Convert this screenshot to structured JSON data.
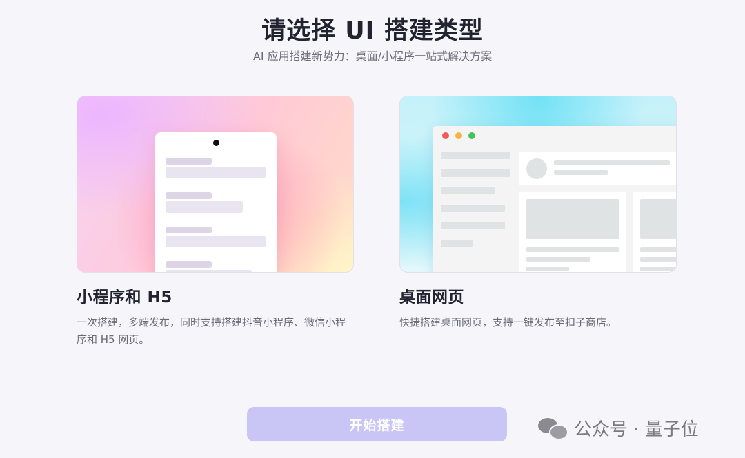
{
  "header": {
    "title": "请选择 UI 搭建类型",
    "subtitle": "AI 应用搭建新势力：桌面/小程序一站式解决方案"
  },
  "options": [
    {
      "id": "mini-program",
      "title": "小程序和 H5",
      "description": "一次搭建，多端发布，同时支持搭建抖音小程序、微信小程序和 H5 网页。",
      "preview_icon": "phone-mockup"
    },
    {
      "id": "desktop-web",
      "title": "桌面网页",
      "description": "快捷搭建桌面网页，支持一键发布至扣子商店。",
      "preview_icon": "browser-window-mockup"
    }
  ],
  "footer": {
    "start_button_label": "开始搭建"
  },
  "watermark": {
    "icon": "wechat-icon",
    "text": "公众号 · 量子位"
  },
  "colors": {
    "background": "#f6f5fa",
    "button_disabled": "#c9c6f6",
    "window_close": "#f25b5b",
    "window_minimize": "#f5b440",
    "window_maximize": "#43c35c"
  }
}
